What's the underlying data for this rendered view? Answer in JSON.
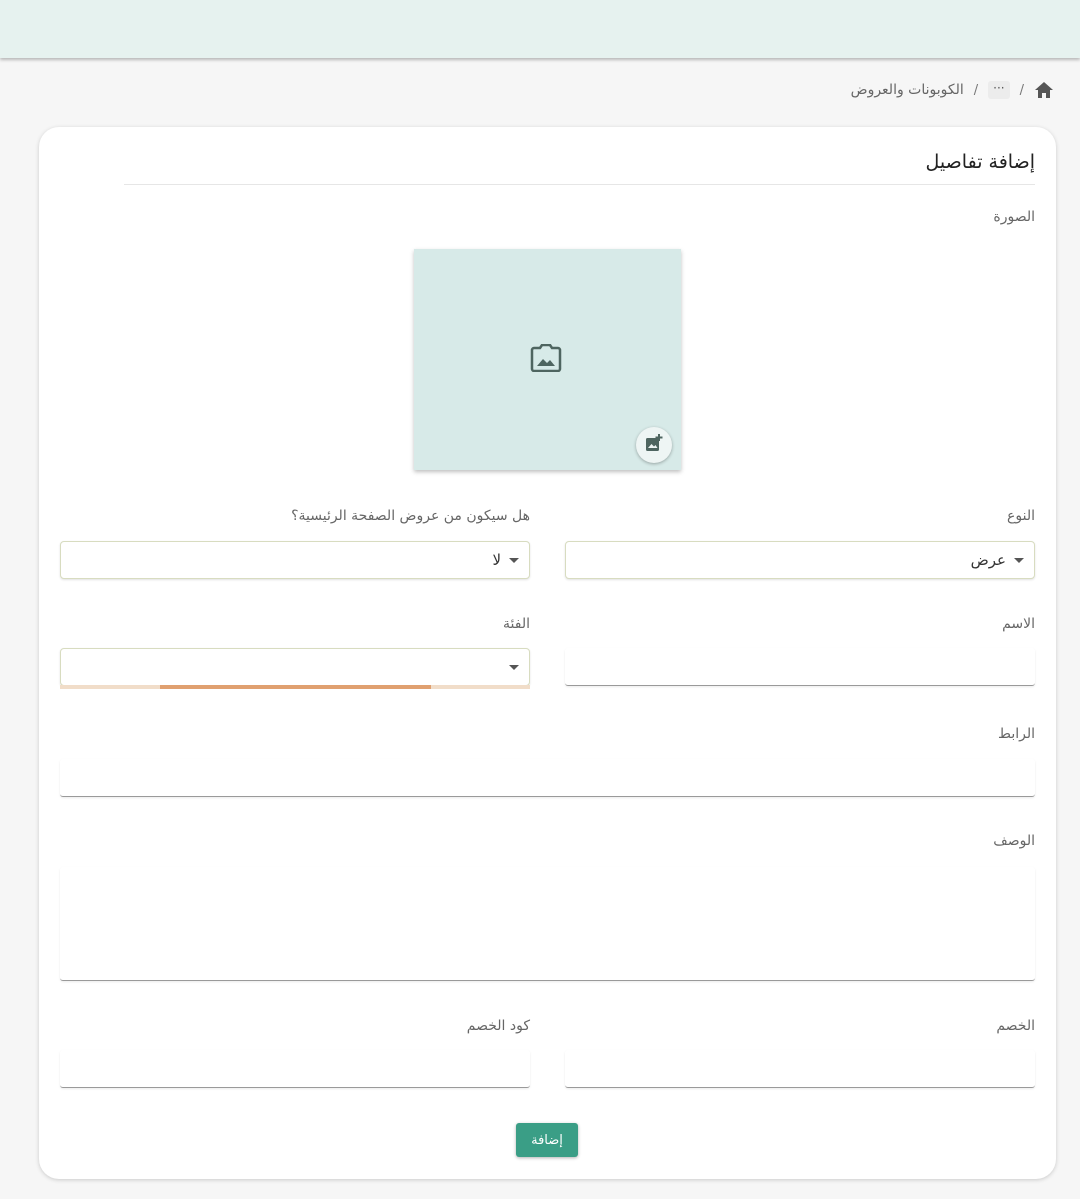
{
  "breadcrumb": {
    "ellipsis": "···",
    "current": "الكوبونات والعروض",
    "separator": "/"
  },
  "form": {
    "title": "إضافة تفاصيل",
    "image_label": "الصورة",
    "type": {
      "label": "النوع",
      "value": "عرض"
    },
    "homepage_offer": {
      "label": "هل سيكون من عروض الصفحة الرئيسية؟",
      "value": "لا"
    },
    "name": {
      "label": "الاسم",
      "value": ""
    },
    "category": {
      "label": "الفئة",
      "value": "",
      "loading_progress": 0.58
    },
    "link": {
      "label": "الرابط",
      "value": ""
    },
    "description": {
      "label": "الوصف",
      "value": ""
    },
    "discount": {
      "label": "الخصم",
      "value": ""
    },
    "discount_code": {
      "label": "كود الخصم",
      "value": ""
    },
    "submit_label": "إضافة"
  },
  "colors": {
    "topbar": "#e6f2ef",
    "accent": "#3a9e86",
    "image_placeholder": "#d7eae8",
    "progress": "#e0a070"
  },
  "icons": [
    "home-icon",
    "image-icon",
    "add-photo-icon",
    "caret-down-icon"
  ]
}
